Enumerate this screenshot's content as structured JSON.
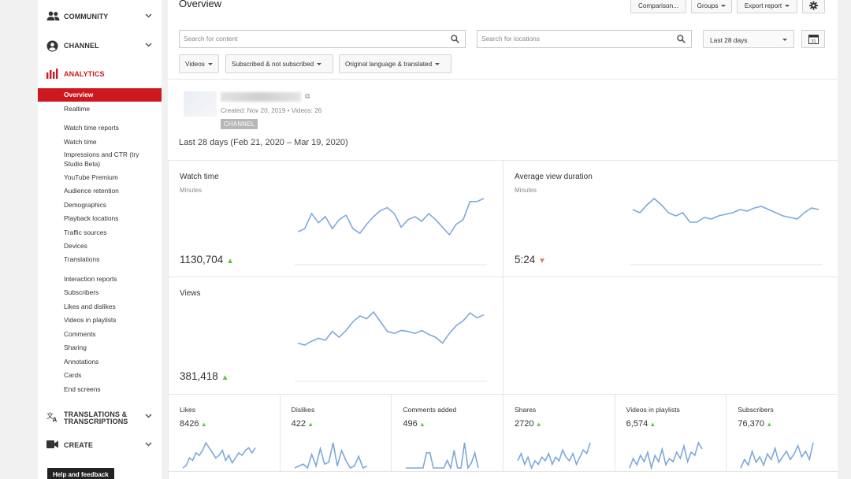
{
  "sidebar": {
    "sections": {
      "community": "COMMUNITY",
      "channel": "CHANNEL",
      "analytics": "ANALYTICS",
      "translations": "TRANSLATIONS & TRANSCRIPTIONS",
      "create": "CREATE"
    },
    "analytics_items": {
      "overview": "Overview",
      "realtime": "Realtime",
      "watch_time_reports": "Watch time reports",
      "watch_time": "Watch time",
      "impressions": "Impressions and CTR (try Studio Beta)",
      "youtube_premium": "YouTube Premium",
      "audience_retention": "Audience retention",
      "demographics": "Demographics",
      "playback_locations": "Playback locations",
      "traffic_sources": "Traffic sources",
      "devices": "Devices",
      "translations": "Translations",
      "interaction_reports": "Interaction reports",
      "subscribers": "Subscribers",
      "likes_dislikes": "Likes and dislikes",
      "videos_in_playlists": "Videos in playlists",
      "comments": "Comments",
      "sharing": "Sharing",
      "annotations": "Annotations",
      "cards": "Cards",
      "end_screens": "End screens"
    },
    "help_button": "Help and feedback"
  },
  "header": {
    "title": "Overview",
    "comparison": "Comparison...",
    "groups": "Groups",
    "export": "Export report"
  },
  "filters": {
    "content_placeholder": "Search for content",
    "location_placeholder": "Search for locations",
    "date_range": "Last 28 days",
    "calendar_day": "31",
    "videos": "Videos",
    "subscribed": "Subscribed & not subscribed",
    "language": "Original language & translated"
  },
  "channel": {
    "meta": "Created: Nov 20, 2019 • Videos: 26",
    "badge": "CHANNEL",
    "range": "Last 28 days (Feb 21, 2020 – Mar 19, 2020)"
  },
  "metrics": {
    "watch_time": {
      "title": "Watch time",
      "unit": "Minutes",
      "value": "1130,704",
      "trend": "up",
      "series": [
        28,
        30,
        40,
        34,
        38,
        30,
        36,
        39,
        30,
        27,
        33,
        38,
        42,
        44,
        40,
        31,
        36,
        38,
        35,
        40,
        36,
        31,
        26,
        33,
        36,
        48,
        48,
        50
      ]
    },
    "avg_view_duration": {
      "title": "Average view duration",
      "unit": "Minutes",
      "value": "5:24",
      "trend": "down",
      "series": [
        42,
        40,
        45,
        49,
        45,
        40,
        38,
        40,
        34,
        34,
        37,
        36,
        38,
        39,
        40,
        42,
        41,
        43,
        44,
        42,
        40,
        38,
        37,
        36,
        40,
        43,
        42
      ]
    },
    "views": {
      "title": "Views",
      "value": "381,418",
      "trend": "up",
      "series": [
        28,
        26,
        30,
        33,
        31,
        40,
        34,
        41,
        50,
        56,
        53,
        60,
        50,
        40,
        38,
        41,
        40,
        38,
        41,
        37,
        34,
        28,
        38,
        46,
        51,
        59,
        54,
        57
      ]
    }
  },
  "mini_metrics": [
    {
      "title": "Likes",
      "value": "8426",
      "series": [
        4,
        5,
        8,
        7,
        10,
        9,
        11,
        14,
        12,
        10,
        8,
        9,
        11,
        7,
        9,
        6,
        8,
        10,
        9,
        11,
        12,
        10,
        12
      ]
    },
    {
      "title": "Dislikes",
      "value": "422",
      "series": [
        2,
        3,
        4,
        2,
        9,
        3,
        12,
        4,
        5,
        15,
        3,
        11,
        6,
        2,
        3,
        8,
        2,
        3
      ]
    },
    {
      "title": "Comments added",
      "value": "496",
      "series": [
        2,
        2,
        2,
        2,
        2,
        2,
        14,
        14,
        2,
        2,
        2,
        2,
        8,
        2,
        16,
        2,
        2,
        22,
        2,
        6,
        14,
        2
      ]
    },
    {
      "title": "Shares",
      "value": "2720",
      "series": [
        9,
        11,
        8,
        10,
        7,
        9,
        8,
        10,
        9,
        11,
        8,
        10,
        9,
        12,
        10,
        9,
        11,
        8,
        10,
        12,
        11,
        14
      ]
    },
    {
      "title": "Videos in playlists",
      "value": "6,574",
      "series": [
        8,
        11,
        9,
        12,
        10,
        13,
        8,
        12,
        10,
        14,
        9,
        11,
        10,
        13,
        11,
        15,
        10,
        13,
        12,
        16,
        14
      ]
    },
    {
      "title": "Subscribers",
      "value": "76,370",
      "series": [
        6,
        9,
        7,
        12,
        8,
        10,
        7,
        11,
        9,
        13,
        8,
        10,
        12,
        9,
        11,
        14,
        10,
        12,
        9,
        15
      ]
    }
  ]
}
